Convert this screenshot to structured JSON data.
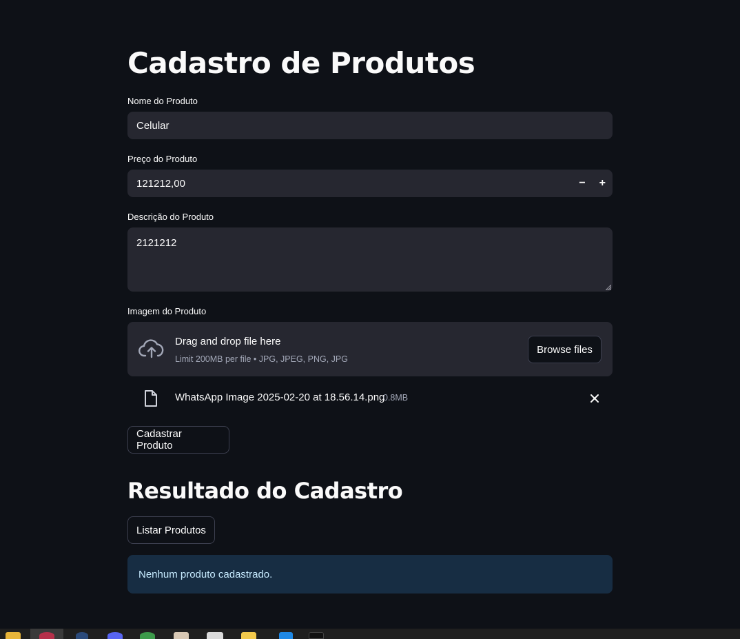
{
  "page": {
    "title": "Cadastro de Produtos"
  },
  "form": {
    "name": {
      "label": "Nome do Produto",
      "value": "Celular"
    },
    "price": {
      "label": "Preço do Produto",
      "value": "121212,00",
      "decrement": "−",
      "increment": "+"
    },
    "description": {
      "label": "Descrição do Produto",
      "value": "2121212"
    },
    "image": {
      "label": "Imagem do Produto",
      "dropzone_title": "Drag and drop file here",
      "dropzone_limit": "Limit 200MB per file • JPG, JPEG, PNG, JPG",
      "browse_label": "Browse files",
      "uploaded_file": {
        "name": "WhatsApp Image 2025-02-20 at 18.56.14.png",
        "size": "0.8MB"
      }
    },
    "submit_label": "Cadastrar Produto"
  },
  "result": {
    "heading": "Resultado do Cadastro",
    "list_button_label": "Listar Produtos",
    "info_message": "Nenhum produto cadastrado."
  },
  "taskbar": {
    "icons": [
      "folder-icon",
      "browser-icon",
      "steam-icon",
      "discord-icon",
      "chrome-icon",
      "app-icon",
      "terminal-icon",
      "python-icon",
      "vscode-icon",
      "app2-icon"
    ]
  },
  "colors": {
    "background": "#0e1117",
    "input_bg": "#262730",
    "info_bg": "#172d43",
    "info_text": "#c7ebff"
  }
}
